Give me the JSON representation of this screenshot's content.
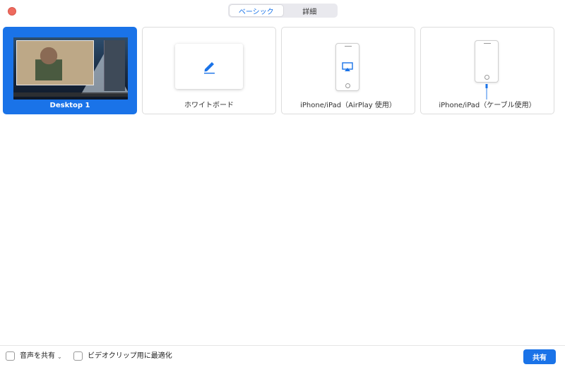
{
  "tabs": [
    {
      "label": "ベーシック",
      "active": true
    },
    {
      "label": "詳細",
      "active": false
    }
  ],
  "sources": [
    {
      "label": "Desktop 1",
      "selected": true,
      "icon": "desktop-thumbnail"
    },
    {
      "label": "ホワイトボード",
      "selected": false,
      "icon": "pencil-icon"
    },
    {
      "label": "iPhone/iPad（AirPlay 使用）",
      "selected": false,
      "icon": "airplay-icon"
    },
    {
      "label": "iPhone/iPad（ケーブル使用）",
      "selected": false,
      "icon": "lightning-cable-icon"
    }
  ],
  "options": {
    "share_audio": {
      "label": "音声を共有",
      "checked": false,
      "dropdown_icon": "chevron-down-icon"
    },
    "optimize_video": {
      "label": "ビデオクリップ用に最適化",
      "checked": false
    }
  },
  "share_button": {
    "label": "共有"
  },
  "colors": {
    "accent": "#1a73e8",
    "close": "#ee6a5e",
    "border": "#dcdcdc"
  }
}
